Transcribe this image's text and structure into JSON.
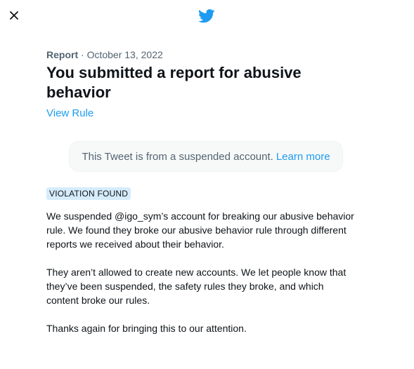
{
  "header": {
    "close_icon": "close-icon",
    "logo_icon": "twitter-bird-icon",
    "brand_color": "#1d9bf0"
  },
  "report": {
    "label": "Report",
    "separator": " · ",
    "date": "October 13, 2022",
    "title": "You submitted a report for abusive behavior",
    "view_rule_label": "View Rule"
  },
  "tweet_notice": {
    "text": "This Tweet is from a suspended account.",
    "learn_more_label": "Learn more"
  },
  "violation_badge": "VIOLATION FOUND",
  "paragraphs": [
    "We suspended @igo_sym’s account for breaking our abusive behavior rule. We found they broke our abusive behavior rule through different reports we received about their behavior.",
    "They aren’t allowed to create new accounts. We let people know that they’ve been suspended, the safety rules they broke, and which content broke our rules.",
    "Thanks again for bringing this to our attention."
  ]
}
